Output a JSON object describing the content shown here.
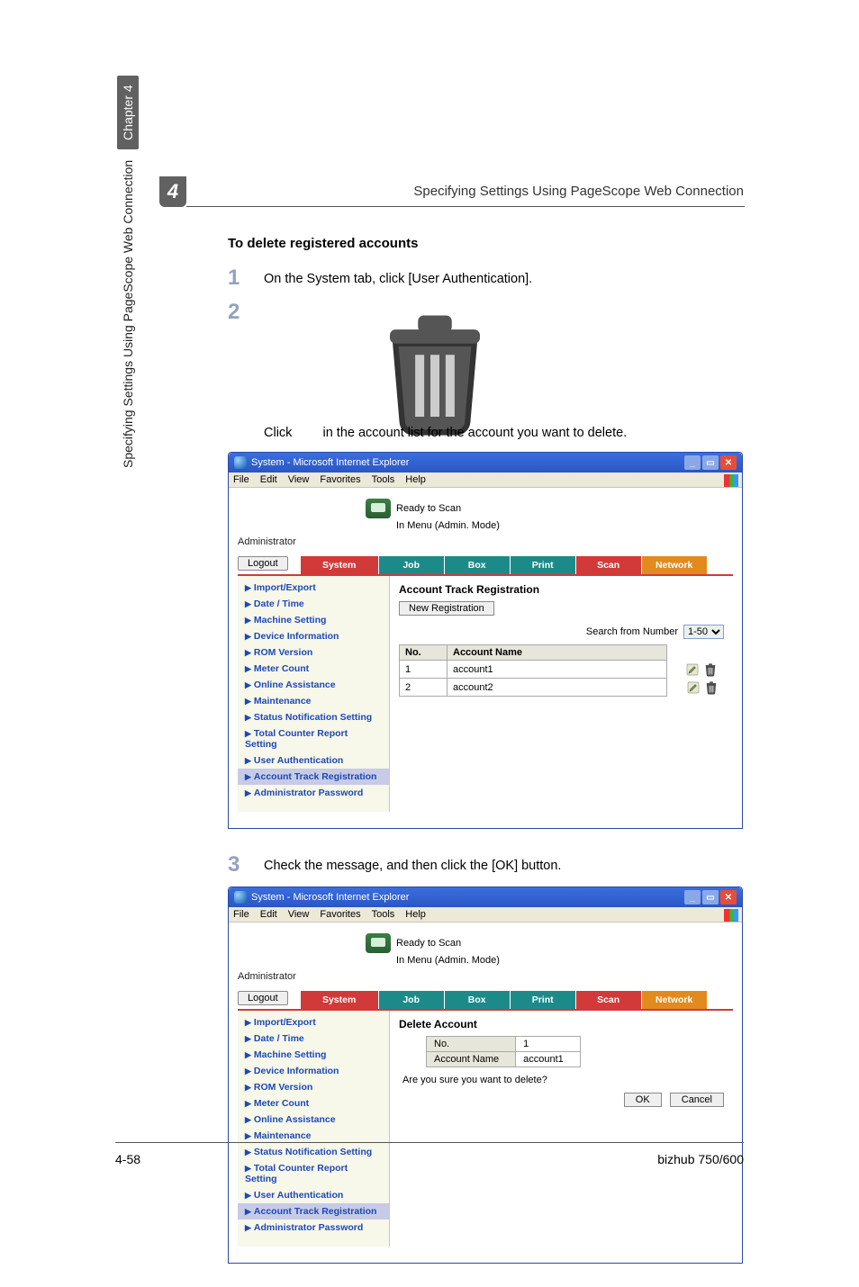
{
  "chapterNumber": "4",
  "headerTitle": "Specifying Settings Using PageScope Web Connection",
  "verticalChapter": "Chapter 4",
  "verticalSpec": "Specifying Settings Using PageScope Web Connection",
  "sectionHead": "To delete registered accounts",
  "steps": {
    "s1num": "1",
    "s1text": "On the System tab, click [User Authentication].",
    "s2num": "2",
    "s2text_a": "Click",
    "s2text_b": "in the account list for the account you want to delete.",
    "s3num": "3",
    "s3text": "Check the message, and then click the [OK] button."
  },
  "ie": {
    "title": "System - Microsoft Internet Explorer",
    "menus": {
      "file": "File",
      "edit": "Edit",
      "view": "View",
      "favorites": "Favorites",
      "tools": "Tools",
      "help": "Help"
    },
    "status1": "Ready to Scan",
    "status2": "In Menu (Admin. Mode)",
    "admin": "Administrator",
    "logout": "Logout",
    "tabs": {
      "system": "System",
      "job": "Job",
      "box": "Box",
      "print": "Print",
      "scan": "Scan",
      "network": "Network"
    },
    "side": [
      "Import/Export",
      "Date / Time",
      "Machine Setting",
      "Device Information",
      "ROM Version",
      "Meter Count",
      "Online Assistance",
      "Maintenance",
      "Status Notification Setting",
      "Total Counter Report Setting",
      "User Authentication",
      "Account Track Registration",
      "Administrator Password"
    ],
    "screen1": {
      "title": "Account Track Registration",
      "newReg": "New Registration",
      "searchLabel": "Search from Number",
      "searchValue": "1-50",
      "col_no": "No.",
      "col_name": "Account Name",
      "rows": [
        {
          "no": "1",
          "name": "account1"
        },
        {
          "no": "2",
          "name": "account2"
        }
      ]
    },
    "screen2": {
      "title": "Delete Account",
      "row_no_label": "No.",
      "row_no_val": "1",
      "row_name_label": "Account Name",
      "row_name_val": "account1",
      "confirm": "Are you sure you want to delete?",
      "ok": "OK",
      "cancel": "Cancel"
    }
  },
  "footer": {
    "pageNum": "4-58",
    "product": "bizhub 750/600"
  }
}
